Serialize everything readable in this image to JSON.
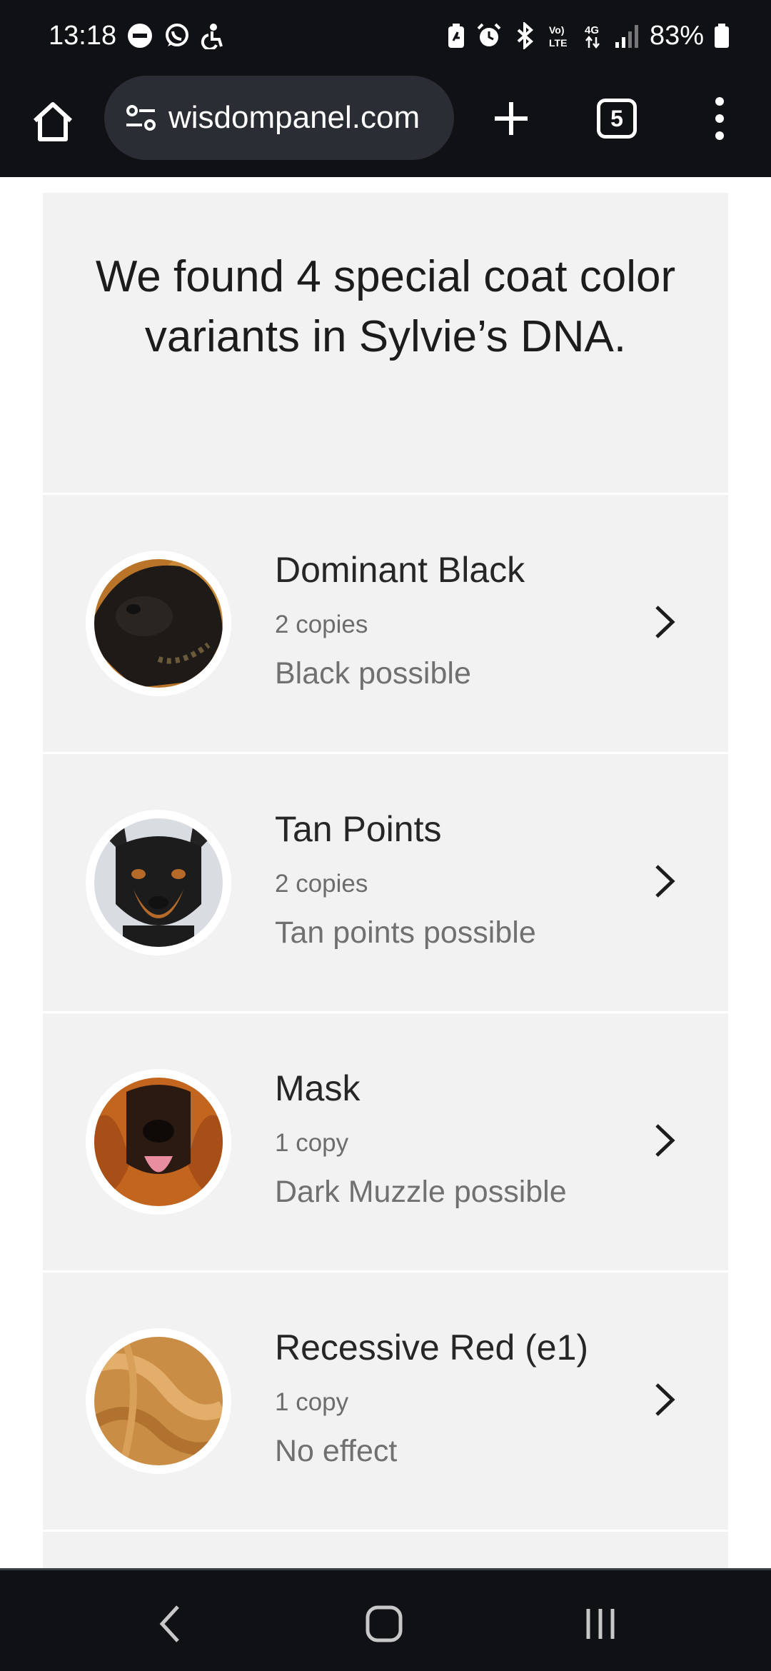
{
  "status_bar": {
    "time": "13:18",
    "battery": "83%",
    "network": "4G",
    "volte": "VoLTE"
  },
  "browser": {
    "url": "wisdompanel.com",
    "tab_count": "5"
  },
  "page": {
    "headline": "We found 4 special coat color variants in Sylvie’s DNA.",
    "variants": [
      {
        "title": "Dominant Black",
        "copies": "2 copies",
        "effect": "Black possible"
      },
      {
        "title": "Tan Points",
        "copies": "2 copies",
        "effect": "Tan points possible"
      },
      {
        "title": "Mask",
        "copies": "1 copy",
        "effect": "Dark Muzzle possible"
      },
      {
        "title": "Recessive Red (e1)",
        "copies": "1 copy",
        "effect": "No effect"
      }
    ]
  },
  "icons": {
    "home": "home-icon",
    "site_info": "site-settings-icon",
    "new_tab": "plus-icon",
    "menu": "more-vert-icon",
    "chevron": "chevron-right-icon",
    "nav_back": "back-icon",
    "nav_home": "home-square-icon",
    "nav_recents": "recents-icon"
  }
}
